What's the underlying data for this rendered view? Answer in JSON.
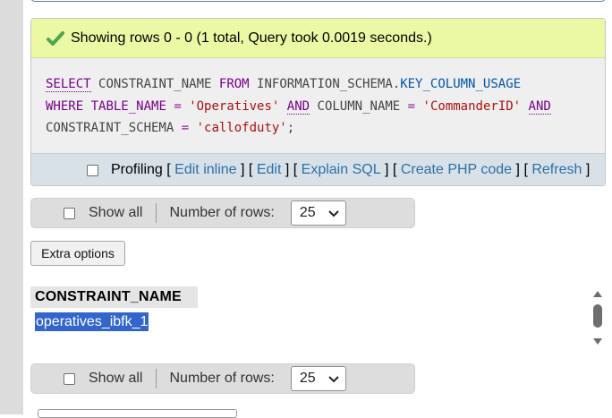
{
  "status": {
    "message": "Showing rows 0 - 0 (1 total, Query took 0.0019 seconds.)"
  },
  "sql": {
    "line1": [
      {
        "t": "SELECT",
        "c": "kwu"
      },
      {
        "t": " ",
        "c": ""
      },
      {
        "t": "CONSTRAINT_NAME",
        "c": "id"
      },
      {
        "t": " ",
        "c": ""
      },
      {
        "t": "FROM",
        "c": "kw"
      },
      {
        "t": " ",
        "c": ""
      },
      {
        "t": "INFORMATION_SCHEMA.",
        "c": "id"
      },
      {
        "t": "KEY_COLUMN_USAGE",
        "c": "id2"
      }
    ],
    "line2": [
      {
        "t": "WHERE",
        "c": "kw"
      },
      {
        "t": " ",
        "c": ""
      },
      {
        "t": "TABLE_NAME",
        "c": "kw"
      },
      {
        "t": " = ",
        "c": "op"
      },
      {
        "t": "'Operatives'",
        "c": "str"
      },
      {
        "t": " ",
        "c": ""
      },
      {
        "t": "AND",
        "c": "kwu"
      },
      {
        "t": " ",
        "c": ""
      },
      {
        "t": "COLUMN_NAME",
        "c": "id"
      },
      {
        "t": " = ",
        "c": "op"
      },
      {
        "t": "'CommanderID'",
        "c": "str"
      },
      {
        "t": " ",
        "c": ""
      },
      {
        "t": "AND",
        "c": "kwu"
      }
    ],
    "line3": [
      {
        "t": "CONSTRAINT_SCHEMA",
        "c": "id"
      },
      {
        "t": " = ",
        "c": "op"
      },
      {
        "t": "'callofduty'",
        "c": "str"
      },
      {
        "t": ";",
        "c": "id"
      }
    ]
  },
  "sql_actions": {
    "profiling": "Profiling",
    "lb1": "[",
    "edit_inline": "Edit inline",
    "rb1": "]",
    "lb2": "[",
    "edit": "Edit",
    "rb2": "]",
    "lb3": "[",
    "explain_sql": "Explain SQL",
    "rb3": "]",
    "lb4": "[",
    "create_php": "Create PHP code",
    "rb4": "]",
    "lb5": "[",
    "refresh": "Refresh",
    "rb5": "]"
  },
  "nav_top": {
    "show_all": "Show all",
    "rows_label": "Number of rows:",
    "rows_value": "25"
  },
  "extra_options": "Extra options",
  "results": {
    "columns": [
      "CONSTRAINT_NAME"
    ],
    "rows": [
      [
        "operatives_ibfk_1"
      ]
    ]
  },
  "nav_bottom": {
    "show_all": "Show all",
    "rows_label": "Number of rows:",
    "rows_value": "25"
  },
  "icons": {
    "success": "check-icon",
    "select": "chevron-down-icon",
    "scroll_up": "arrow-up-icon",
    "scroll_down": "arrow-down-icon"
  },
  "colors": {
    "success_bg": "#ebf8a4",
    "link": "#2d6fa6",
    "selection": "#3366cc"
  }
}
